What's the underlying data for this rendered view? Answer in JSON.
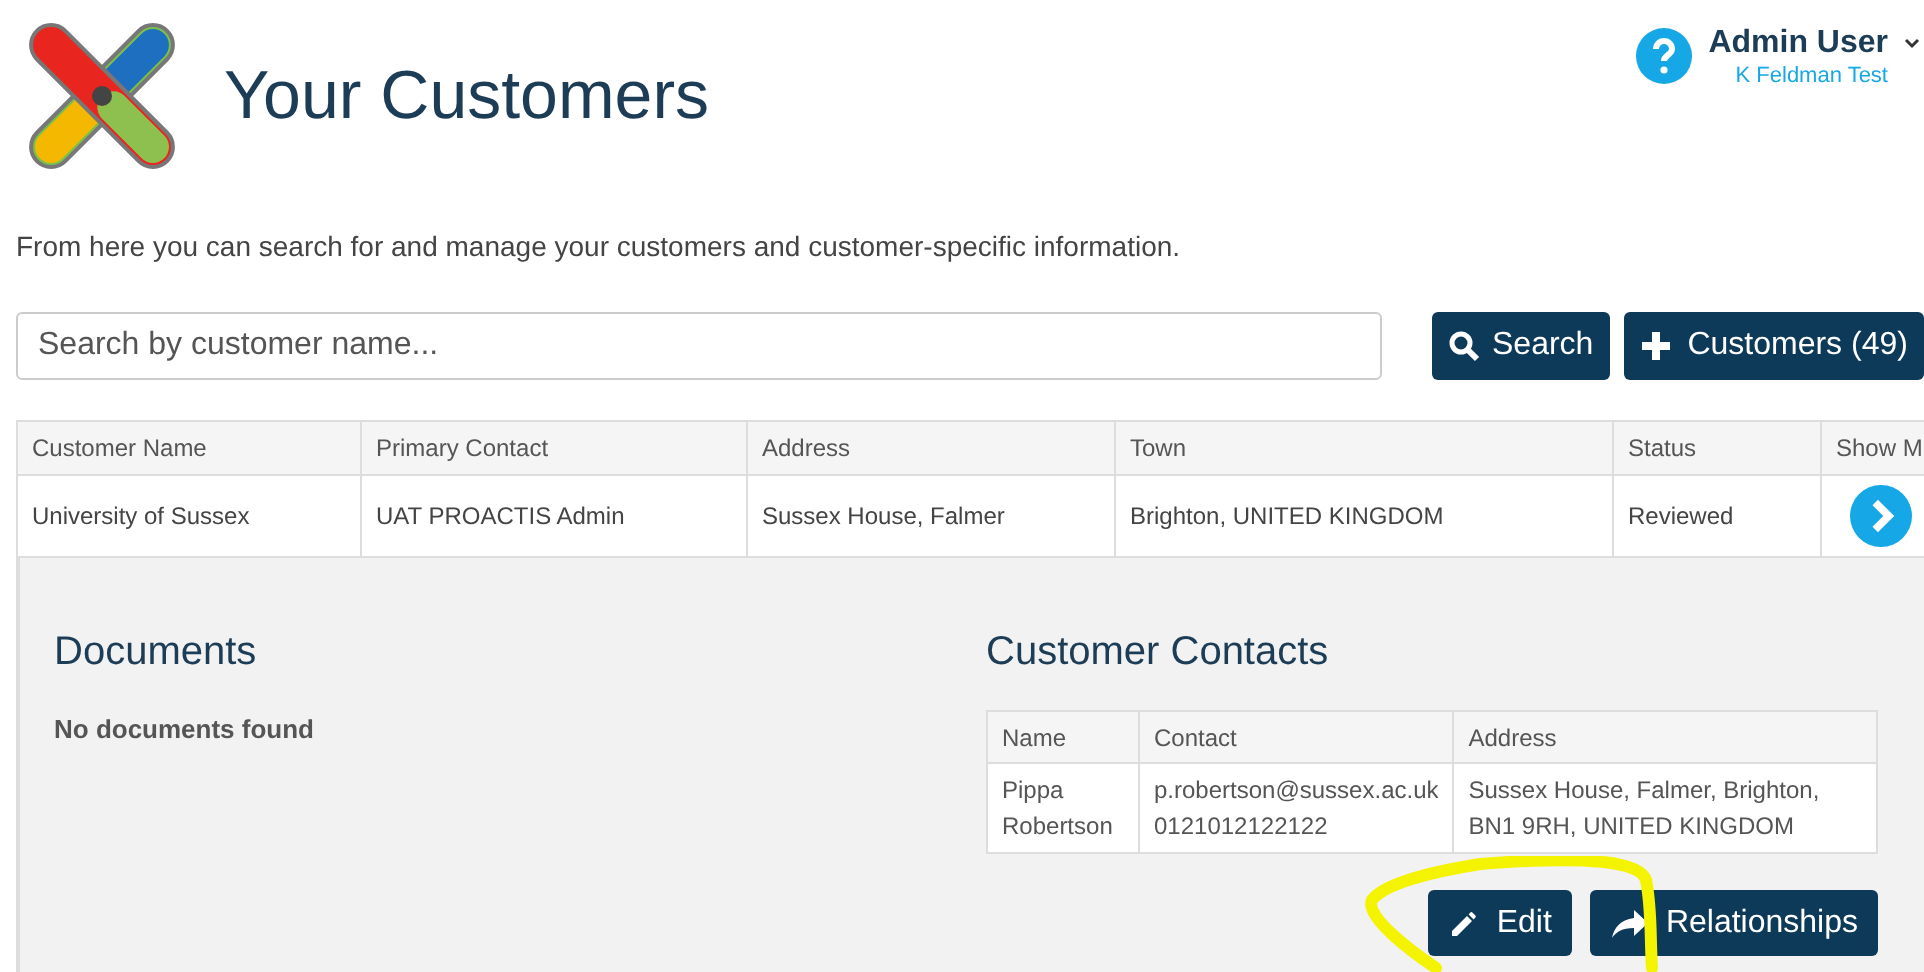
{
  "header": {
    "title": "Your Customers",
    "user": {
      "name": "Admin User",
      "subtitle": "K Feldman Test"
    }
  },
  "intro": "From here you can search for and manage your customers and customer-specific information.",
  "search": {
    "placeholder": "Search by customer name...",
    "button": "Search",
    "add_button": "Customers (49)"
  },
  "table": {
    "columns": [
      "Customer Name",
      "Primary Contact",
      "Address",
      "Town",
      "Status",
      "Show M"
    ],
    "rows": [
      {
        "cells": [
          "University of Sussex",
          "UAT PROACTIS Admin",
          "Sussex House, Falmer",
          "Brighton, UNITED KINGDOM",
          "Reviewed"
        ],
        "expanded": true
      }
    ]
  },
  "details": {
    "documents": {
      "title": "Documents",
      "empty": "No documents found"
    },
    "contacts": {
      "title": "Customer Contacts",
      "columns": [
        "Name",
        "Contact",
        "Address"
      ],
      "rows": [
        {
          "name": "Pippa Robertson",
          "contact": [
            "p.robertson@sussex.ac.uk",
            "0121012122122"
          ],
          "address": "Sussex House, Falmer, Brighton, BN1 9RH, UNITED KINGDOM"
        }
      ]
    },
    "buttons": [
      {
        "kind": "edit",
        "label": "Edit"
      },
      {
        "kind": "share",
        "label": "Relationships"
      }
    ]
  }
}
